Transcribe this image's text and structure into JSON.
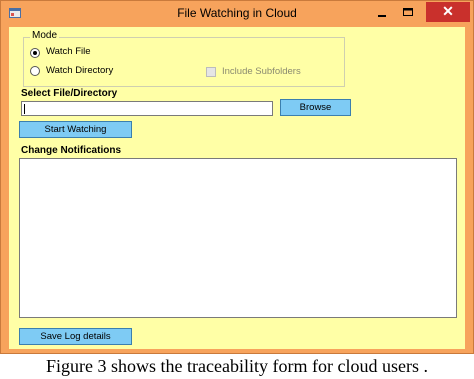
{
  "window": {
    "title": "File Watching in Cloud",
    "close_glyph": "✕"
  },
  "mode": {
    "legend": "Mode",
    "options": [
      {
        "label": "Watch File",
        "checked": true
      },
      {
        "label": "Watch Directory",
        "checked": false
      }
    ],
    "include_subfolders": {
      "label": "Include Subfolders",
      "checked": false,
      "enabled": false
    }
  },
  "select": {
    "title": "Select File/Directory",
    "path_value": "",
    "browse_label": "Browse"
  },
  "start_label": "Start Watching",
  "notifications": {
    "title": "Change Notifications",
    "content": ""
  },
  "save_label": "Save Log details",
  "caption": "Figure 3 shows the traceability form for cloud users ."
}
